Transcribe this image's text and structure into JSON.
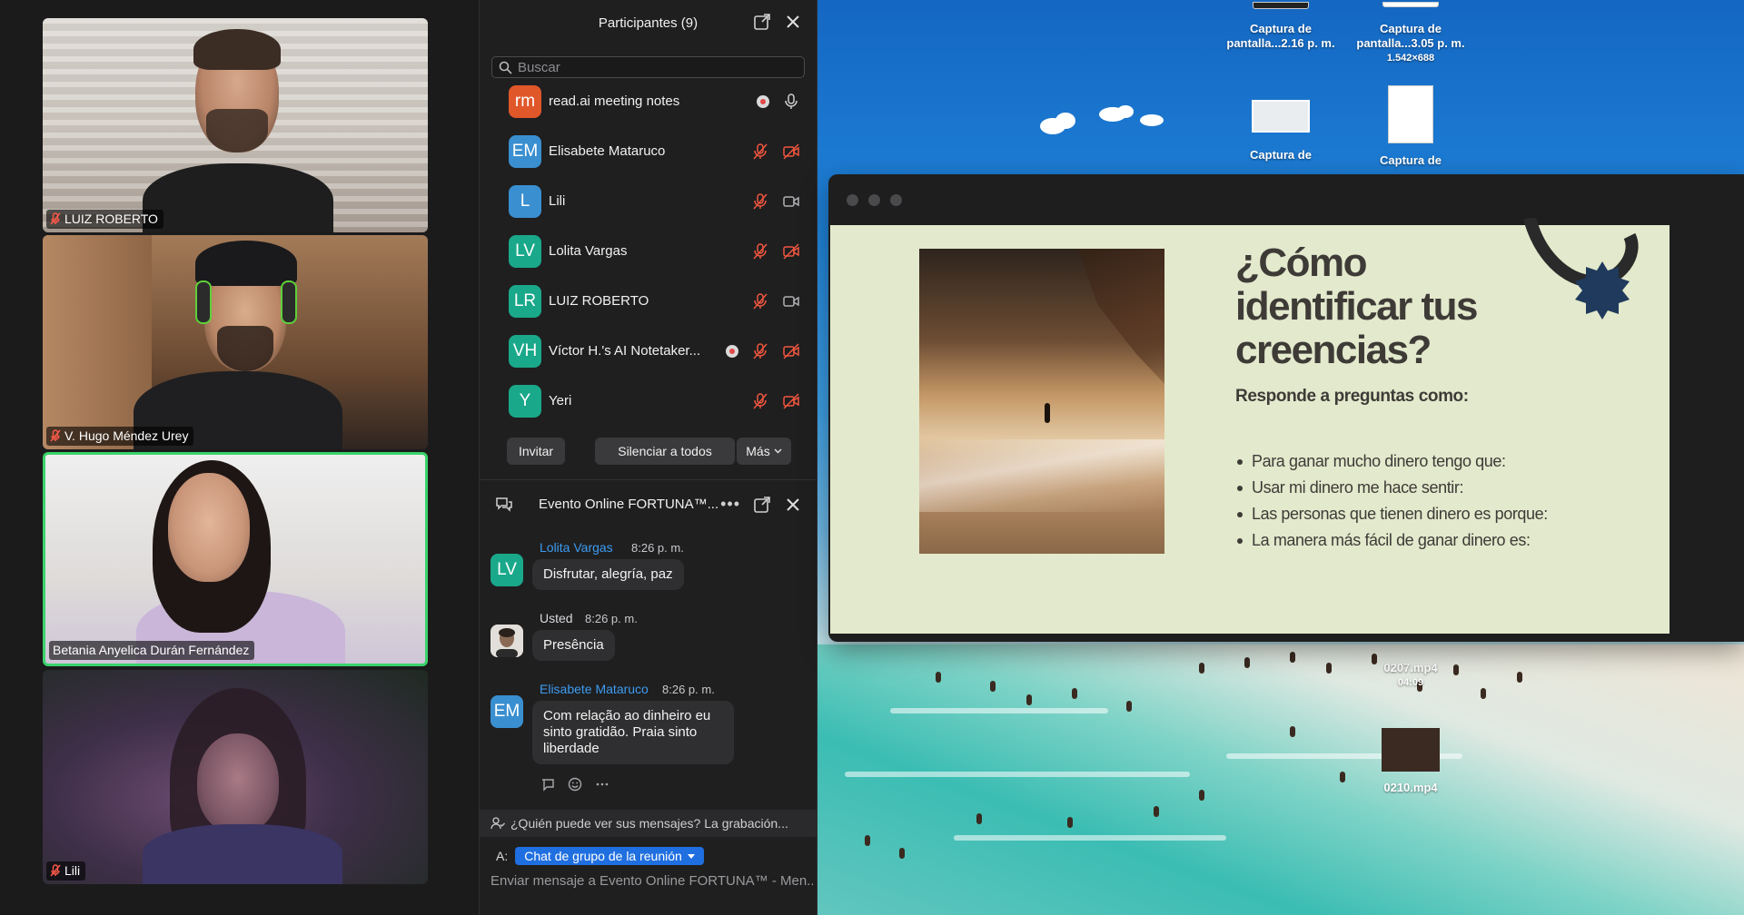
{
  "gallery": {
    "tiles": [
      {
        "name": "LUIZ ROBERTO",
        "muted": true
      },
      {
        "name": "V. Hugo Méndez Urey",
        "muted": true
      },
      {
        "name": "Betania Anyelica Durán Fernández",
        "muted": false,
        "active_speaker": true
      },
      {
        "name": "Lili",
        "muted": true
      }
    ]
  },
  "participants": {
    "title": "Participantes (9)",
    "search_placeholder": "Buscar",
    "list": [
      {
        "initials": "rm",
        "name": "read.ai meeting notes",
        "color": "#e0572a",
        "recording": true,
        "mic": "on",
        "video": "none"
      },
      {
        "initials": "EM",
        "name": "Elisabete Mataruco",
        "color": "#3a8fd0",
        "recording": false,
        "mic": "muted",
        "video": "off"
      },
      {
        "initials": "L",
        "name": "Lili",
        "color": "#3a8fd0",
        "recording": false,
        "mic": "muted",
        "video": "on"
      },
      {
        "initials": "LV",
        "name": "Lolita Vargas",
        "color": "#1aa88a",
        "recording": false,
        "mic": "muted",
        "video": "off"
      },
      {
        "initials": "LR",
        "name": "LUIZ ROBERTO",
        "color": "#1aa88a",
        "recording": false,
        "mic": "muted",
        "video": "on"
      },
      {
        "initials": "VH",
        "name": "Víctor H.'s AI Notetaker...",
        "color": "#1aa88a",
        "recording": true,
        "mic": "muted",
        "video": "off"
      },
      {
        "initials": "Y",
        "name": "Yeri",
        "color": "#1aa88a",
        "recording": false,
        "mic": "muted",
        "video": "off"
      }
    ],
    "buttons": {
      "invite": "Invitar",
      "mute_all": "Silenciar a todos",
      "more": "Más"
    }
  },
  "chat": {
    "title": "Evento Online FORTUNA™...",
    "messages": [
      {
        "initials": "LV",
        "sender": "Lolita Vargas",
        "time": "8:26 p. m.",
        "text": "Disfrutar, alegría, paz",
        "color": "#1aa88a"
      },
      {
        "initials": "",
        "sender": "Usted",
        "time": "8:26 p. m.",
        "text": "Presência",
        "color": "#cfcfcf"
      },
      {
        "initials": "EM",
        "sender": "Elisabete Mataruco",
        "time": "8:26 p. m.",
        "text": "Com relação ao dinheiro eu sinto gratidão. Praia sinto liberdade",
        "color": "#3a8fd0"
      }
    ],
    "privacy_notice": "¿Quién puede ver sus mensajes? La grabación...",
    "to_label": "A:",
    "to_target": "Chat de grupo de la reunión",
    "composer_placeholder": "Enviar mensaje a Evento Online FORTUNA™ - Men..."
  },
  "desktop": {
    "icons": [
      {
        "label_line1": "Captura de",
        "label_line2": "pantalla...2.16 p. m.",
        "sub": ""
      },
      {
        "label_line1": "Captura de",
        "label_line2": "pantalla...3.05 p. m.",
        "sub": "1.542×688"
      },
      {
        "label_line1": "Captura de",
        "label_line2": "",
        "sub": ""
      },
      {
        "label_line1": "Captura de",
        "label_line2": "",
        "sub": ""
      },
      {
        "label_line1": "0207.mp4",
        "label_line2": "04:09",
        "sub": ""
      },
      {
        "label_line1": "0210.mp4",
        "label_line2": "",
        "sub": ""
      }
    ]
  },
  "slide": {
    "title": "¿Cómo identificar tus creencias?",
    "subtitle": "Responde a preguntas como:",
    "bullets": [
      "Para ganar mucho dinero tengo que:",
      "Usar mi dinero me hace sentir:",
      "Las personas que tienen dinero es porque:",
      "La manera más fácil de ganar dinero es:"
    ],
    "accent_color": "#1f3a5c"
  }
}
